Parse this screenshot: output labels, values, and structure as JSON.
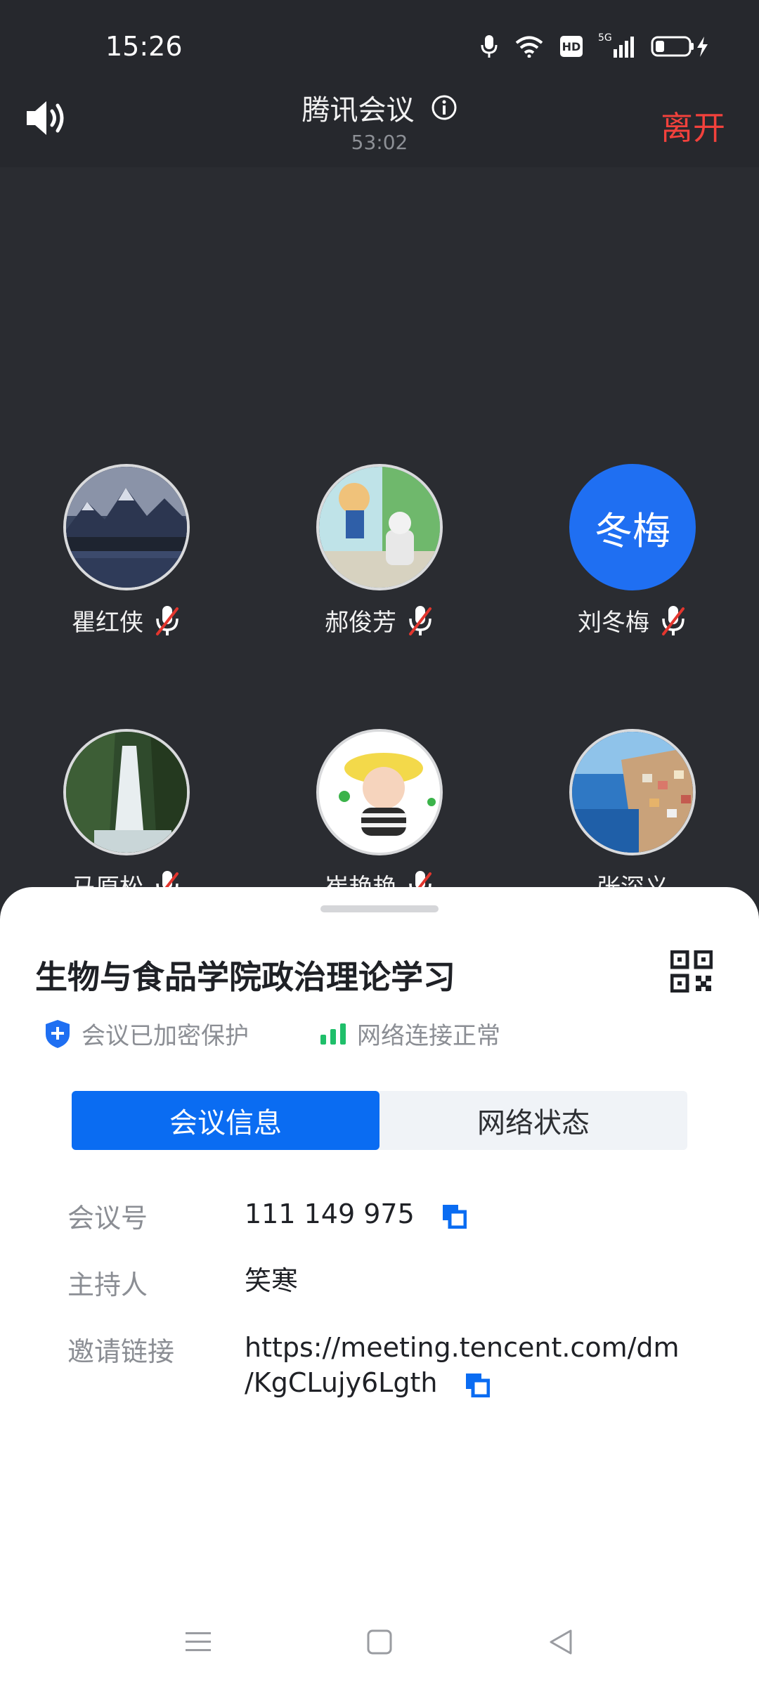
{
  "status_bar": {
    "time": "15:26",
    "network": "5G",
    "hd_label": "HD"
  },
  "header": {
    "title": "腾讯会议",
    "duration": "53:02",
    "leave_label": "离开"
  },
  "participants": [
    {
      "name": "瞿红侠",
      "muted": true,
      "avatar": "photo-mountain-lake"
    },
    {
      "name": "郝俊芳",
      "muted": true,
      "avatar": "photo-anime-girl"
    },
    {
      "name": "刘冬梅",
      "muted": true,
      "avatar_text": "冬梅",
      "avatar_color": "#1f6ff2"
    },
    {
      "name": "马原松",
      "muted": true,
      "avatar": "photo-waterfall"
    },
    {
      "name": "崔艳艳",
      "muted": true,
      "avatar": "photo-child"
    },
    {
      "name": "张深义",
      "muted": false,
      "avatar": "photo-coast-town"
    }
  ],
  "sheet": {
    "meeting_title": "生物与食品学院政治理论学习",
    "encryption_label": "会议已加密保护",
    "network_label": "网络连接正常",
    "tabs": [
      {
        "label": "会议信息",
        "active": true
      },
      {
        "label": "网络状态",
        "active": false
      }
    ],
    "info": {
      "meeting_id_label": "会议号",
      "meeting_id": "111 149 975",
      "host_label": "主持人",
      "host": "笑寒",
      "invite_label": "邀请链接",
      "invite_line1": "https://meeting.tencent.com/dm",
      "invite_line2": "/KgCLujy6Lgth"
    }
  },
  "colors": {
    "accent": "#0a6cf2",
    "leave": "#f2413c",
    "secure": "#1f6ff2",
    "network_ok": "#1fbf6a",
    "mic_muted": "#e3362e"
  }
}
